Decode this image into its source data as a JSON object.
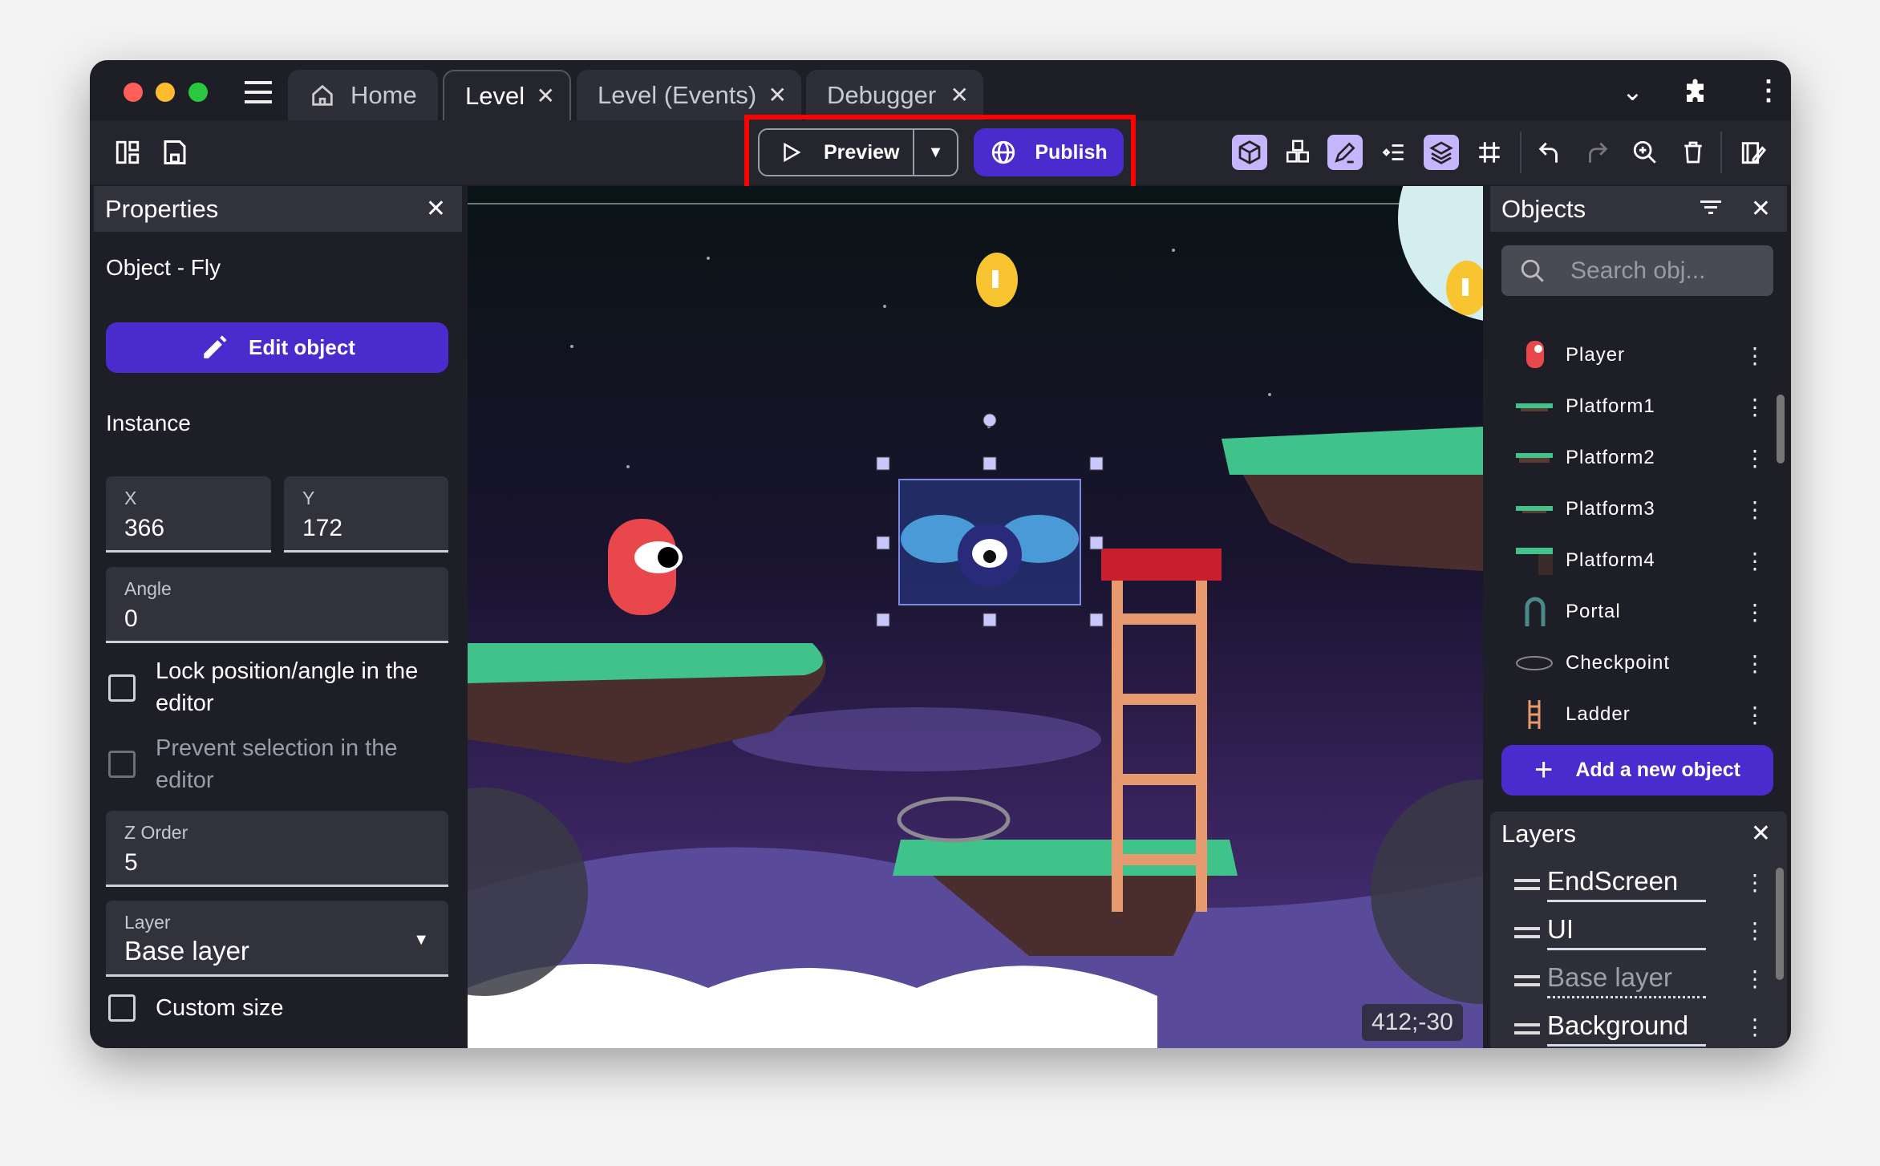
{
  "window": {
    "traffic_lights": [
      "#ff5f57",
      "#febc2e",
      "#28c840"
    ]
  },
  "tabs": [
    {
      "label": "Home",
      "icon": "home-icon"
    },
    {
      "label": "Level",
      "active": true
    },
    {
      "label": "Level (Events)"
    },
    {
      "label": "Debugger"
    }
  ],
  "toolbar": {
    "preview_label": "Preview",
    "publish_label": "Publish",
    "accent": "#4a2bce",
    "highlight": "#ff0000",
    "icons": [
      "object-editor-icon",
      "object-groups-icon",
      "properties-edit-icon",
      "instances-list-icon",
      "layers-icon",
      "grid-icon",
      "undo-icon",
      "redo-icon",
      "zoom-icon",
      "delete-icon",
      "scene-properties-icon"
    ]
  },
  "properties": {
    "title": "Properties",
    "object_label": "Object  - Fly",
    "edit_button": "Edit object",
    "instance_heading": "Instance",
    "x_label": "X",
    "x_value": "366",
    "y_label": "Y",
    "y_value": "172",
    "angle_label": "Angle",
    "angle_value": "0",
    "lock_label": "Lock position/angle in the editor",
    "lock_checked": false,
    "prevent_label": "Prevent selection in the editor",
    "prevent_checked": false,
    "z_label": "Z Order",
    "z_value": "5",
    "layer_label": "Layer",
    "layer_value": "Base layer",
    "custom_size_label": "Custom size",
    "custom_size_checked": false
  },
  "canvas": {
    "cursor_coords": "412;-30"
  },
  "objects": {
    "title": "Objects",
    "search_placeholder": "Search obj...",
    "add_button": "Add a new object",
    "items": [
      {
        "name": "Player"
      },
      {
        "name": "Platform1"
      },
      {
        "name": "Platform2"
      },
      {
        "name": "Platform3"
      },
      {
        "name": "Platform4"
      },
      {
        "name": "Portal"
      },
      {
        "name": "Checkpoint"
      },
      {
        "name": "Ladder"
      }
    ]
  },
  "layers": {
    "title": "Layers",
    "items": [
      {
        "name": "EndScreen"
      },
      {
        "name": "UI"
      },
      {
        "name": "Base layer",
        "selected": true
      },
      {
        "name": "Background"
      }
    ]
  }
}
